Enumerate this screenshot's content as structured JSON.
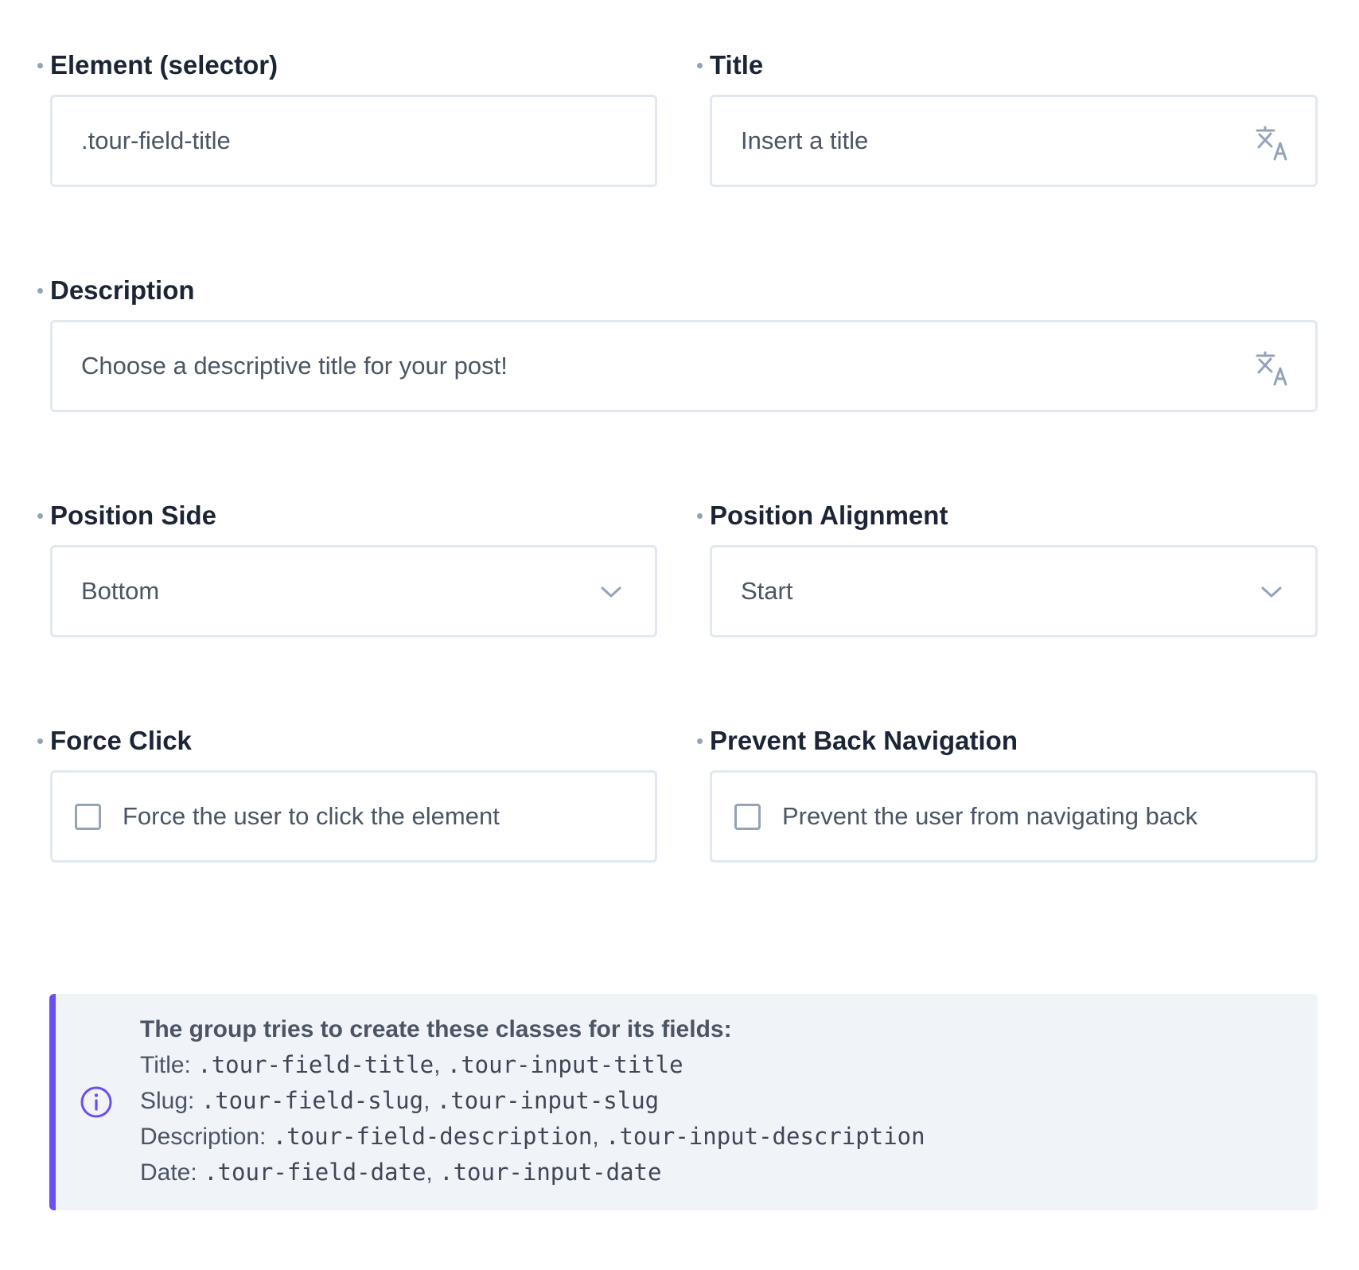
{
  "form": {
    "element_selector": {
      "label": "Element (selector)",
      "value": ".tour-field-title"
    },
    "title": {
      "label": "Title",
      "placeholder": "Insert a title",
      "icon": "translate-icon"
    },
    "description": {
      "label": "Description",
      "placeholder": "Choose a descriptive title for your post!",
      "icon": "translate-icon"
    },
    "position_side": {
      "label": "Position Side",
      "selected": "Bottom"
    },
    "position_alignment": {
      "label": "Position Alignment",
      "selected": "Start"
    },
    "force_click": {
      "label": "Force Click",
      "checkbox_label": "Force the user to click the element",
      "checked": false
    },
    "prevent_back_navigation": {
      "label": "Prevent Back Navigation",
      "checkbox_label": "Prevent the user from navigating back",
      "checked": false
    }
  },
  "info": {
    "icon": "info-circle-icon",
    "heading": "The group tries to create these classes for its fields:",
    "rows": [
      {
        "prefix": "Title:",
        "field_class": ".tour-field-title",
        "sep": ",",
        "input_class": ".tour-input-title"
      },
      {
        "prefix": "Slug:",
        "field_class": ".tour-field-slug",
        "sep": ",",
        "input_class": ".tour-input-slug"
      },
      {
        "prefix": "Description:",
        "field_class": ".tour-field-description",
        "sep": ",",
        "input_class": ".tour-input-description"
      },
      {
        "prefix": "Date:",
        "field_class": ".tour-field-date",
        "sep": ",",
        "input_class": ".tour-input-date"
      }
    ]
  },
  "colors": {
    "accent": "#6b4df0",
    "border": "#e2e8f0",
    "label": "#1c2536",
    "text": "#4b5563",
    "muted_icon": "#94a3b8",
    "info_bg": "#f0f3f8"
  }
}
